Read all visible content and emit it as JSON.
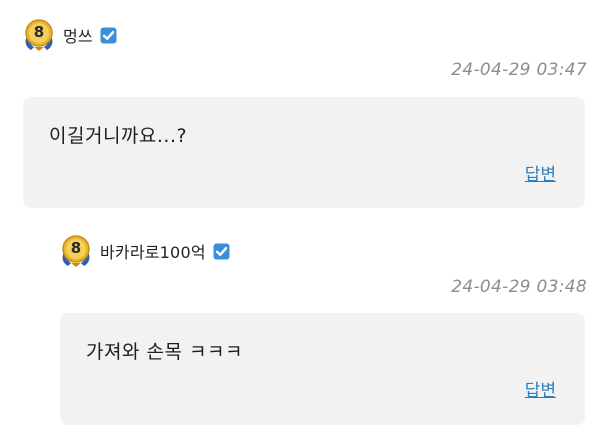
{
  "comments": [
    {
      "level": "8",
      "author": "멍쓰",
      "timestamp": "24-04-29 03:47",
      "text": "이길거니까요...?",
      "reply_label": "답변",
      "verified_icon": "check-verified-icon",
      "badge_icon": "level-medal-icon"
    },
    {
      "level": "8",
      "author": "바카라로100억",
      "timestamp": "24-04-29 03:48",
      "text": "가져와 손목 ㅋㅋㅋ",
      "reply_label": "답변",
      "verified_icon": "check-verified-icon",
      "badge_icon": "level-medal-icon"
    }
  ],
  "colors": {
    "bubble_bg": "#f2f2f2",
    "link": "#2a7fc0",
    "timestamp": "#8d8d8d",
    "verified": "#3b8fd9",
    "medal_gold": "#e8b531",
    "medal_ribbon": "#2f5fb3"
  }
}
